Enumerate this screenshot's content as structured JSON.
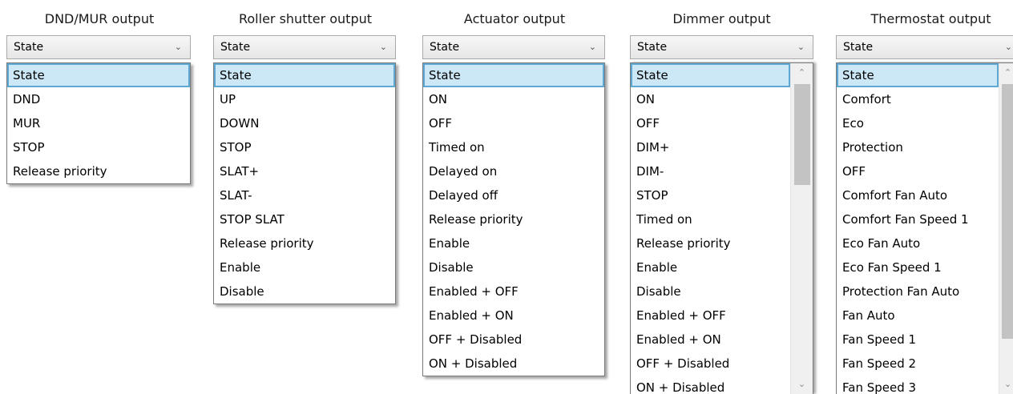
{
  "dnd_mur": {
    "title": "DND/MUR output",
    "selected_value": "State",
    "options": [
      "State",
      "DND",
      "MUR",
      "STOP",
      "Release priority"
    ]
  },
  "roller_shutter": {
    "title": "Roller shutter output",
    "selected_value": "State",
    "options": [
      "State",
      "UP",
      "DOWN",
      "STOP",
      "SLAT+",
      "SLAT-",
      "STOP SLAT",
      "Release priority",
      "Enable",
      "Disable"
    ]
  },
  "actuator": {
    "title": "Actuator output",
    "selected_value": "State",
    "options": [
      "State",
      "ON",
      "OFF",
      "Timed on",
      "Delayed on",
      "Delayed off",
      "Release priority",
      "Enable",
      "Disable",
      "Enabled + OFF",
      "Enabled + ON",
      "OFF + Disabled",
      "ON + Disabled"
    ]
  },
  "dimmer": {
    "title": "Dimmer output",
    "selected_value": "State",
    "options": [
      "State",
      "ON",
      "OFF",
      "DIM+",
      "DIM-",
      "STOP",
      "Timed on",
      "Release priority",
      "Enable",
      "Disable",
      "Enabled + OFF",
      "Enabled + ON",
      "OFF + Disabled",
      "ON + Disabled"
    ]
  },
  "thermostat": {
    "title": "Thermostat output",
    "selected_value": "State",
    "options": [
      "State",
      "Comfort",
      "Eco",
      "Protection",
      "OFF",
      "Comfort Fan Auto",
      "Comfort Fan Speed 1",
      "Eco Fan Auto",
      "Eco Fan Speed 1",
      "Protection Fan Auto",
      "Fan Auto",
      "Fan Speed 1",
      "Fan Speed 2",
      "Fan Speed 3"
    ]
  },
  "icons": {
    "chevron": "chevron-down-icon",
    "scroll_up": "scroll-up-arrow-icon",
    "scroll_down": "scroll-down-arrow-icon"
  }
}
